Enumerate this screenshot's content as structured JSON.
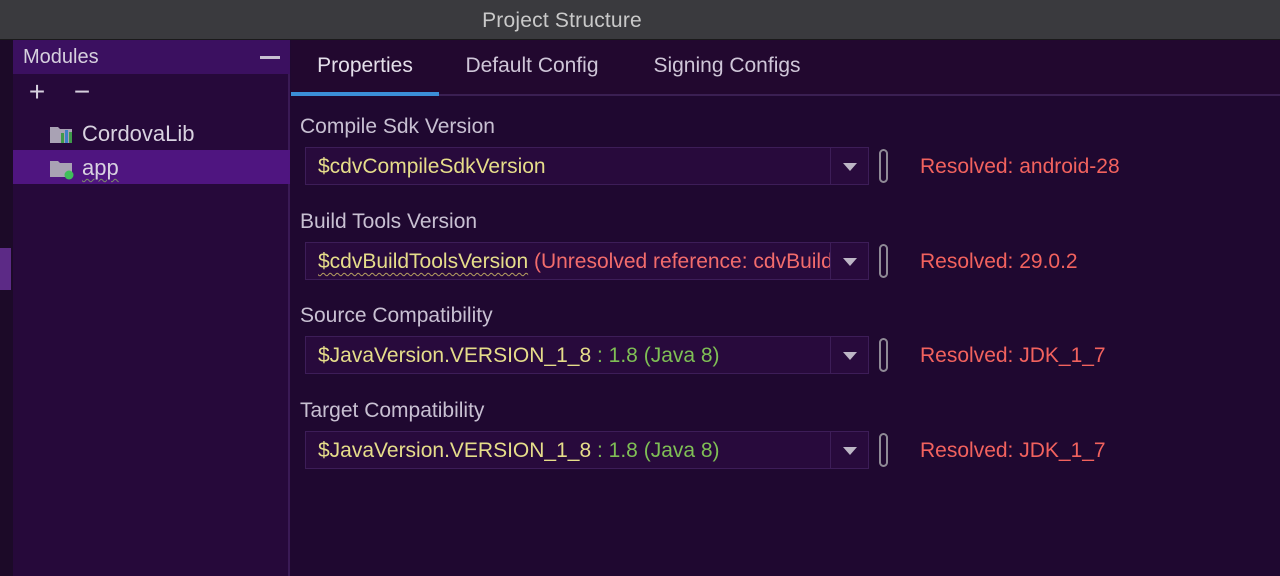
{
  "window": {
    "title": "Project Structure"
  },
  "sidebar": {
    "header_label": "Modules",
    "toolbar": {
      "add_label": "+",
      "remove_label": "−"
    },
    "items": [
      {
        "label": "CordovaLib",
        "icon": "library-module-icon",
        "selected": false
      },
      {
        "label": "app",
        "icon": "app-module-icon",
        "selected": true
      }
    ]
  },
  "tabs": [
    {
      "label": "Properties",
      "active": true
    },
    {
      "label": "Default Config",
      "active": false
    },
    {
      "label": "Signing Configs",
      "active": false
    }
  ],
  "fields": [
    {
      "label": "Compile Sdk Version",
      "value": "$cdvCompileSdkVersion",
      "value_suffix": "",
      "resolved": "Resolved: android-28"
    },
    {
      "label": "Build Tools Version",
      "value": "$cdvBuildToolsVersion",
      "value_suffix": "(Unresolved reference: cdvBuildToolsVersion)",
      "resolved": "Resolved: 29.0.2"
    },
    {
      "label": "Source Compatibility",
      "value": "$JavaVersion.VERSION_1_8",
      "value_suffix": ": 1.8 (Java 8)",
      "resolved": "Resolved: JDK_1_7"
    },
    {
      "label": "Target Compatibility",
      "value": "$JavaVersion.VERSION_1_8",
      "value_suffix": ": 1.8 (Java 8)",
      "resolved": "Resolved: JDK_1_7"
    }
  ],
  "colors": {
    "accent": "#3b8fd8",
    "selection": "#4f1580",
    "variable": "#e6dd8a",
    "inline_value": "#7fbf55",
    "error": "#f26c6c"
  }
}
